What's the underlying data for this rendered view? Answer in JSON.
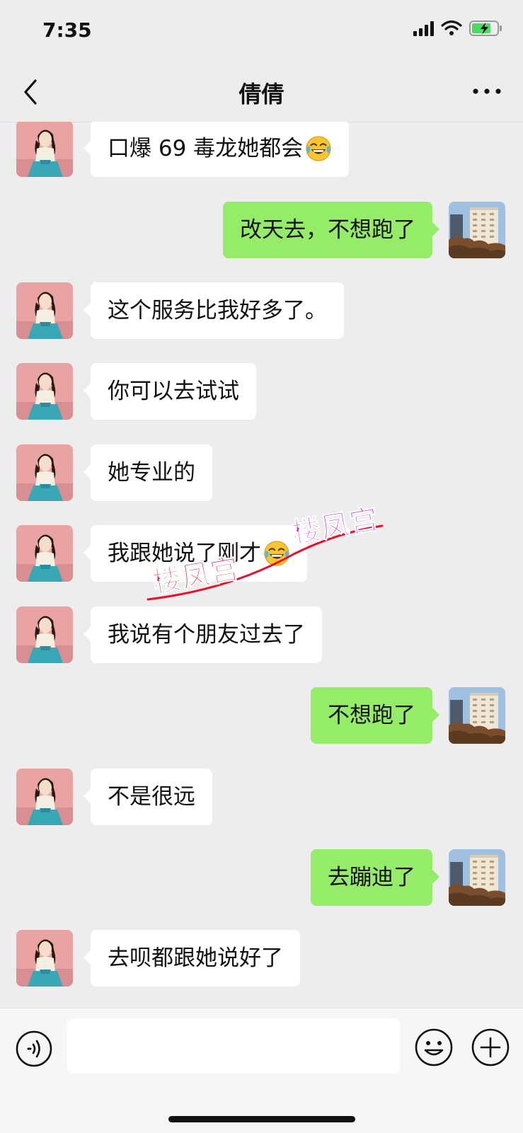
{
  "status_bar": {
    "time": "7:35"
  },
  "header": {
    "title": "倩倩"
  },
  "messages": [
    {
      "side": "left",
      "text": "口爆 69 毒龙她都会",
      "emoji": "laughing-tears"
    },
    {
      "side": "right",
      "text": "改天去，不想跑了"
    },
    {
      "side": "left",
      "text": "这个服务比我好多了。"
    },
    {
      "side": "left",
      "text": "你可以去试试"
    },
    {
      "side": "left",
      "text": "她专业的"
    },
    {
      "side": "left",
      "text": "我跟她说了刚才",
      "emoji": "laughing-tears"
    },
    {
      "side": "left",
      "text": "我说有个朋友过去了"
    },
    {
      "side": "right",
      "text": "不想跑了"
    },
    {
      "side": "left",
      "text": "不是很远"
    },
    {
      "side": "right",
      "text": "去蹦迪了"
    },
    {
      "side": "left",
      "text": "去呗都跟她说好了"
    }
  ],
  "watermark": {
    "text_red": "楼凤宫",
    "text_purple": "楼凤宫"
  },
  "input_bar": {
    "value": ""
  },
  "colors": {
    "background": "#ededed",
    "bubble_incoming": "#ffffff",
    "bubble_outgoing": "#95ec69",
    "watermark_red": "#e8102a",
    "watermark_purple": "#c117e6"
  },
  "icons": [
    "back-chevron-icon",
    "more-dots-icon",
    "voice-icon",
    "emoji-icon",
    "plus-icon",
    "laughing-tears-emoji-icon"
  ]
}
